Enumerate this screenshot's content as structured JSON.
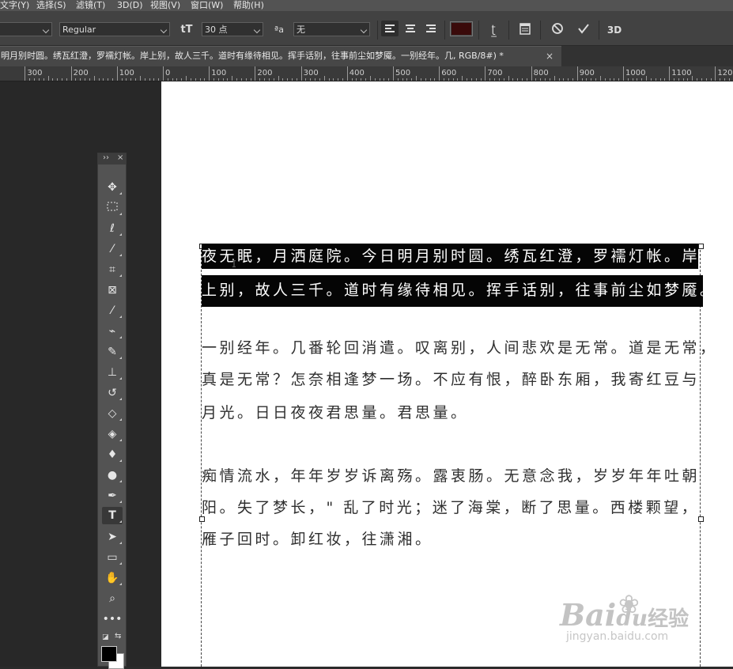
{
  "menu": {
    "items": [
      "文字(Y)",
      "选择(S)",
      "滤镜(T)",
      "3D(D)",
      "视图(V)",
      "窗口(W)",
      "帮助(H)"
    ]
  },
  "options": {
    "font_family_value": "",
    "font_style_value": "Regular",
    "font_size_value": "30 点",
    "antialias_value": "无",
    "text_color": "#3a0a0a",
    "icons": [
      "text-orientation-icon",
      "font-size-icon",
      "antialias-icon",
      "align-left-icon",
      "align-center-icon",
      "align-right-icon",
      "warp-text-icon",
      "character-panel-icon",
      "cancel-icon",
      "commit-icon",
      "3d-icon"
    ]
  },
  "document_tab": {
    "title": "明月别时圆。绣瓦红澄，罗襦灯帐。岸上别，故人三千。道时有缘待相见。挥手话别，往事前尘如梦魇。一别经年。几, RGB/8#) *",
    "close": "×"
  },
  "ruler": {
    "labels": [
      "300",
      "200",
      "100",
      "0",
      "100",
      "200",
      "300",
      "400",
      "500",
      "600",
      "700",
      "800",
      "900",
      "1000",
      "1100",
      "1200"
    ]
  },
  "toolbar": {
    "head_left": "››",
    "head_right": "×",
    "tools": [
      "move-icon",
      "marquee-icon",
      "lasso-icon",
      "magic-wand-icon",
      "crop-icon",
      "frame-icon",
      "eyedropper-icon",
      "healing-brush-icon",
      "brush-icon",
      "clone-stamp-icon",
      "history-brush-icon",
      "eraser-icon",
      "paint-bucket-icon",
      "blur-icon",
      "dodge-icon",
      "pen-icon",
      "type-icon",
      "path-selection-icon",
      "rectangle-icon",
      "hand-icon",
      "zoom-icon",
      "more-tools-icon"
    ],
    "active_tool": "type-icon"
  },
  "canvas_text": {
    "lines": [
      "夜无眠，月洒庭院。今日明月别时圆。绣瓦红澄，罗襦灯帐。岸",
      "上别，故人三千。道时有缘待相见。挥手话别，往事前尘如梦魇。",
      "一别经年。几番轮回消遣。叹离别，人间悲欢是无常。道是无常，",
      "真是无常？怎奈相逢梦一场。不应有恨，醉卧东厢，我寄红豆与",
      "月光。日日夜夜君思量。君思量。",
      "痴情流水，年年岁岁诉离殇。露衷肠。无意念我，岁岁年年吐朝",
      "阳。失了梦长，\" 乱了时光；迷了海棠，断了思量。西楼颗望，",
      "雁子回时。卸红妆，往潇湘。"
    ]
  },
  "watermark": {
    "brand": "Bai",
    "brand2": "du",
    "brand3": "经验",
    "url": "jingyan.baidu.com"
  }
}
